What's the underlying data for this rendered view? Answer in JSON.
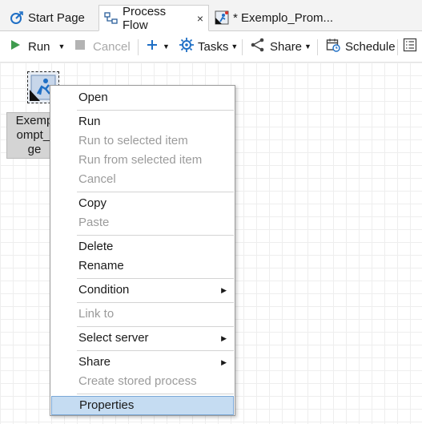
{
  "tabs": [
    {
      "label": "Start Page",
      "icon": "start-page-icon"
    },
    {
      "label": "Process Flow",
      "icon": "process-flow-icon",
      "close": "×"
    },
    {
      "label": "* Exemplo_Prom...",
      "icon": "program-icon"
    }
  ],
  "toolbar": {
    "run": "Run",
    "cancel": "Cancel",
    "tasks": "Tasks",
    "share": "Share",
    "schedule": "Schedule"
  },
  "node": {
    "label_lines": [
      "Exemp",
      "ompt_l",
      "ge"
    ]
  },
  "context_menu": {
    "items": [
      {
        "label": "Open",
        "enabled": true
      },
      {
        "label": "Run",
        "enabled": true
      },
      {
        "label": "Run to selected item",
        "enabled": false
      },
      {
        "label": "Run from selected item",
        "enabled": false
      },
      {
        "label": "Cancel",
        "enabled": false
      },
      {
        "label": "Copy",
        "enabled": true
      },
      {
        "label": "Paste",
        "enabled": false
      },
      {
        "label": "Delete",
        "enabled": true
      },
      {
        "label": "Rename",
        "enabled": true
      },
      {
        "label": "Condition",
        "enabled": true,
        "submenu": true
      },
      {
        "label": "Link to",
        "enabled": false
      },
      {
        "label": "Select server",
        "enabled": true,
        "submenu": true
      },
      {
        "label": "Share",
        "enabled": true,
        "submenu": true
      },
      {
        "label": "Create stored process",
        "enabled": false
      },
      {
        "label": "Properties",
        "enabled": true,
        "highlighted": true
      }
    ]
  },
  "colors": {
    "accent_blue": "#1f6fc5",
    "menu_highlight": "#c5dcf2",
    "run_green": "#3f9b4e"
  }
}
